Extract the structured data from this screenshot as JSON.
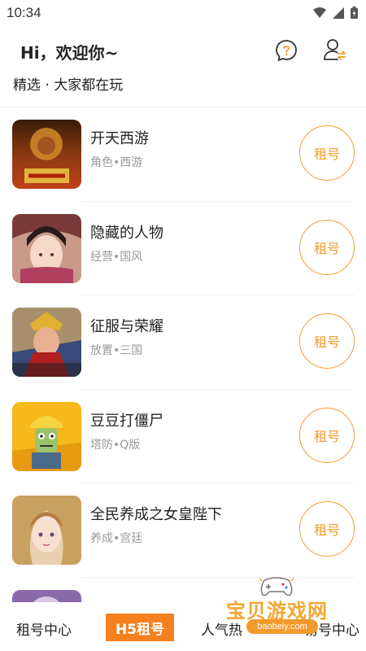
{
  "status_bar": {
    "time": "10:34",
    "icons": [
      "wifi-icon",
      "signal-icon",
      "battery-icon"
    ]
  },
  "header": {
    "greeting": "Hi，欢迎你~",
    "subtitle": "精选 · 大家都在玩",
    "icons": [
      "help-icon",
      "user-switch-icon"
    ]
  },
  "games": [
    {
      "name": "开天西游",
      "tags": "角色•西游",
      "action": "租号"
    },
    {
      "name": "隐藏的人物",
      "tags": "经营•国风",
      "action": "租号"
    },
    {
      "name": "征服与荣耀",
      "tags": "放置•三国",
      "action": "租号"
    },
    {
      "name": "豆豆打僵尸",
      "tags": "塔防•Q版",
      "action": "租号"
    },
    {
      "name": "全民养成之女皇陛下",
      "tags": "养成•宫廷",
      "action": "租号"
    }
  ],
  "bottom_nav": {
    "tabs": [
      "租号中心",
      "H5租号",
      "人气热",
      "易号中心"
    ],
    "active_index": 1
  },
  "watermark": {
    "text": "宝贝游戏网",
    "url": "baobeiy.com"
  },
  "colors": {
    "accent": "#f39a2c",
    "active_tab": "#f4801f",
    "tag": "#9a9a9a"
  }
}
